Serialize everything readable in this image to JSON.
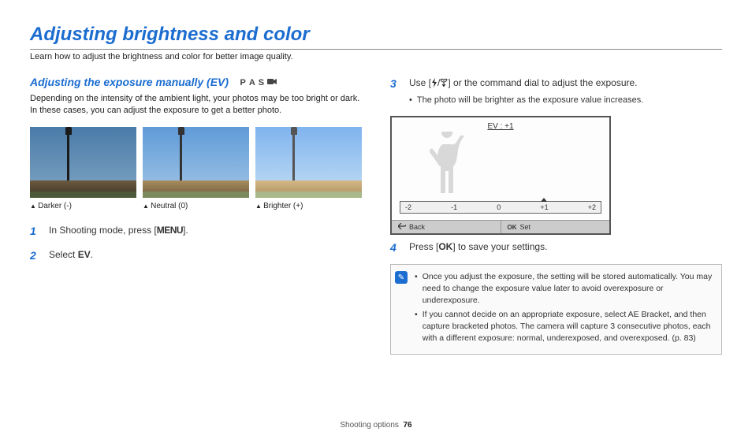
{
  "main_title": "Adjusting brightness and color",
  "main_sub": "Learn how to adjust the brightness and color for better image quality.",
  "section": {
    "title": "Adjusting the exposure manually (EV)",
    "modes": [
      "P",
      "A",
      "S"
    ],
    "desc": "Depending on the intensity of the ambient light, your photos may be too bright or dark. In these cases, you can adjust the exposure to get a better photo."
  },
  "examples": [
    {
      "caption": "Darker (-)"
    },
    {
      "caption": "Neutral (0)"
    },
    {
      "caption": "Brighter (+)"
    }
  ],
  "steps_left": [
    {
      "num": "1",
      "text_before": "In Shooting mode, press [",
      "label": "MENU",
      "text_after": "]."
    },
    {
      "num": "2",
      "text_before": "Select ",
      "label": "EV",
      "text_after": "."
    }
  ],
  "steps_right": {
    "step3": {
      "num": "3",
      "text_before": "Use [",
      "text_mid": "/",
      "text_after": "] or the command dial to adjust the exposure.",
      "bullet": "The photo will be brighter as the exposure value increases."
    },
    "step4": {
      "num": "4",
      "text_before": "Press [",
      "label": "OK",
      "text_after": "] to save your settings."
    }
  },
  "ev_screen": {
    "title": "EV : +1",
    "scale": [
      "-2",
      "-1",
      "0",
      "+1",
      "+2"
    ],
    "back": "Back",
    "set": "Set"
  },
  "note": {
    "items": [
      "Once you adjust the exposure, the setting will be stored automatically. You may need to change the exposure value later to avoid overexposure or underexposure.",
      "If you cannot decide on an appropriate exposure, select AE Bracket, and then capture bracketed photos. The camera will capture 3 consecutive photos, each with a different exposure: normal, underexposed, and overexposed. (p. 83)"
    ]
  },
  "footer": {
    "section": "Shooting options",
    "page": "76"
  }
}
